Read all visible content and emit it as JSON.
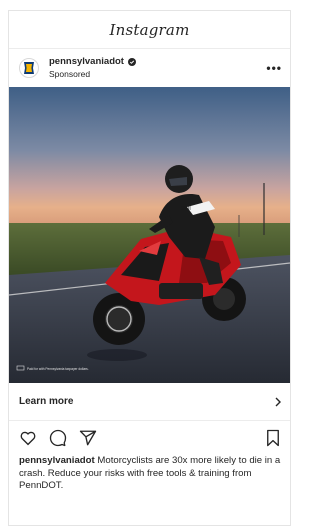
{
  "app": {
    "title": "Instagram"
  },
  "post": {
    "handle": "pennsylvaniadot",
    "sponsored_label": "Sponsored",
    "more_label": "•••",
    "media": {
      "disclaimer": "Paid for with Pennsylvania taxpayer dollars.",
      "jacket_text": "SIDI"
    },
    "cta": {
      "label": "Learn more",
      "chevron": "›"
    },
    "caption": {
      "handle": "pennsylvaniadot",
      "text": "Motorcyclists are 30x more likely to die in a crash. Reduce your risks with free tools & training from PennDOT."
    },
    "icons": {
      "avatar": "keystone-logo-icon",
      "verified": "verified-badge-icon",
      "like": "heart-icon",
      "comment": "comment-icon",
      "share": "send-icon",
      "save": "bookmark-icon",
      "cta": "chevron-right-icon",
      "more": "more-options-icon"
    }
  }
}
